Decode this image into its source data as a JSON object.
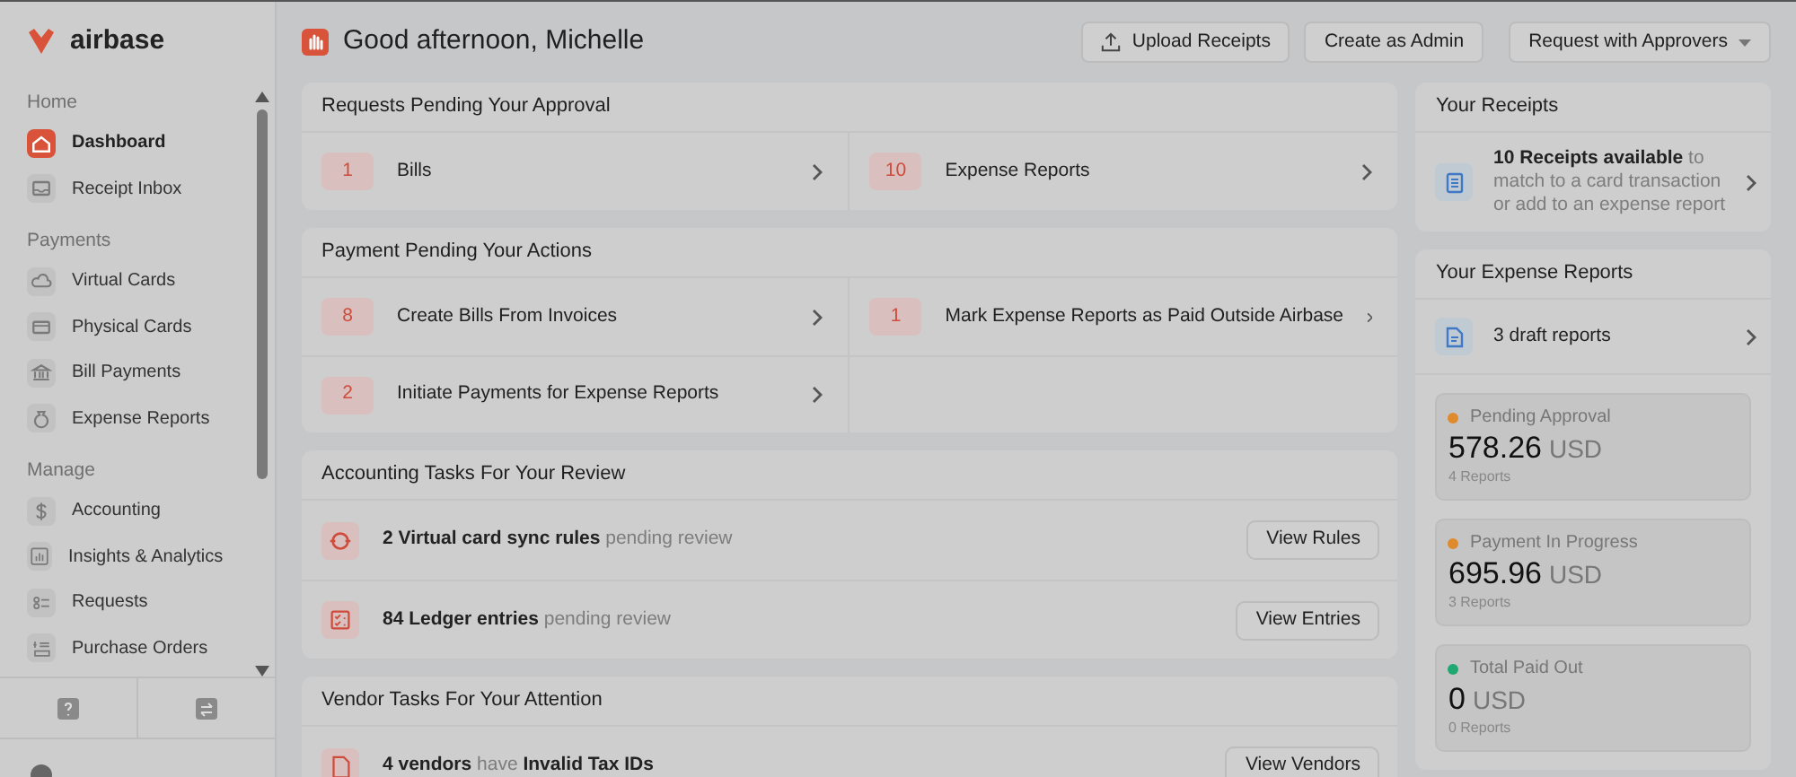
{
  "brand": "airbase",
  "sidebar": {
    "sections": [
      {
        "label": "Home",
        "items": [
          {
            "label": "Dashboard",
            "selected": true
          },
          {
            "label": "Receipt Inbox",
            "selected": false
          }
        ]
      },
      {
        "label": "Payments",
        "items": [
          {
            "label": "Virtual Cards",
            "selected": false
          },
          {
            "label": "Physical Cards",
            "selected": false
          },
          {
            "label": "Bill Payments",
            "selected": false
          },
          {
            "label": "Expense Reports",
            "selected": false
          }
        ]
      },
      {
        "label": "Manage",
        "items": [
          {
            "label": "Accounting",
            "selected": false
          },
          {
            "label": "Insights & Analytics",
            "selected": false
          },
          {
            "label": "Requests",
            "selected": false
          },
          {
            "label": "Purchase Orders",
            "selected": false
          }
        ]
      }
    ]
  },
  "header": {
    "greeting": "Good afternoon, Michelle",
    "buttons": [
      "Upload Receipts",
      "Create as Admin",
      "Request with Approvers"
    ]
  },
  "requests_pending": {
    "title": "Requests Pending Your Approval",
    "items": [
      {
        "count": "1",
        "label": "Bills"
      },
      {
        "count": "10",
        "label": "Expense Reports"
      }
    ]
  },
  "payment_pending": {
    "title": "Payment Pending Your Actions",
    "items": [
      {
        "count": "8",
        "label": "Create Bills From Invoices"
      },
      {
        "count": "1",
        "label": "Mark Expense Reports as Paid Outside Airbase"
      },
      {
        "count": "2",
        "label": "Initiate Payments for Expense Reports"
      }
    ]
  },
  "accounting_tasks": {
    "title": "Accounting Tasks For Your Review",
    "items": [
      {
        "text": "**2 Virtual card sync rules** pending review",
        "button": "View Rules"
      },
      {
        "text": "**84 Ledger entries** pending review",
        "button": "View Entries"
      }
    ]
  },
  "vendor_tasks": {
    "title": "Vendor Tasks For Your Attention",
    "items": [
      {
        "text": "**4 vendors** have **Invalid Tax IDs**",
        "button": "View Vendors"
      }
    ]
  },
  "your_receipts": {
    "title": "Your Receipts",
    "text": "**10 Receipts available** to match to a card transaction or add to an expense report"
  },
  "your_expense_reports": {
    "title": "Your Expense Reports",
    "drafts": "3 draft reports",
    "stats": [
      {
        "label": "Pending Approval",
        "amount": "578.26",
        "currency": "USD",
        "reports": "4 Reports",
        "color": "#e08a2e"
      },
      {
        "label": "Payment In Progress",
        "amount": "695.96",
        "currency": "USD",
        "reports": "3 Reports",
        "color": "#e08a2e"
      },
      {
        "label": "Total Paid Out",
        "amount": "0",
        "currency": "USD",
        "reports": "0 Reports",
        "color": "#1fa971"
      }
    ]
  }
}
